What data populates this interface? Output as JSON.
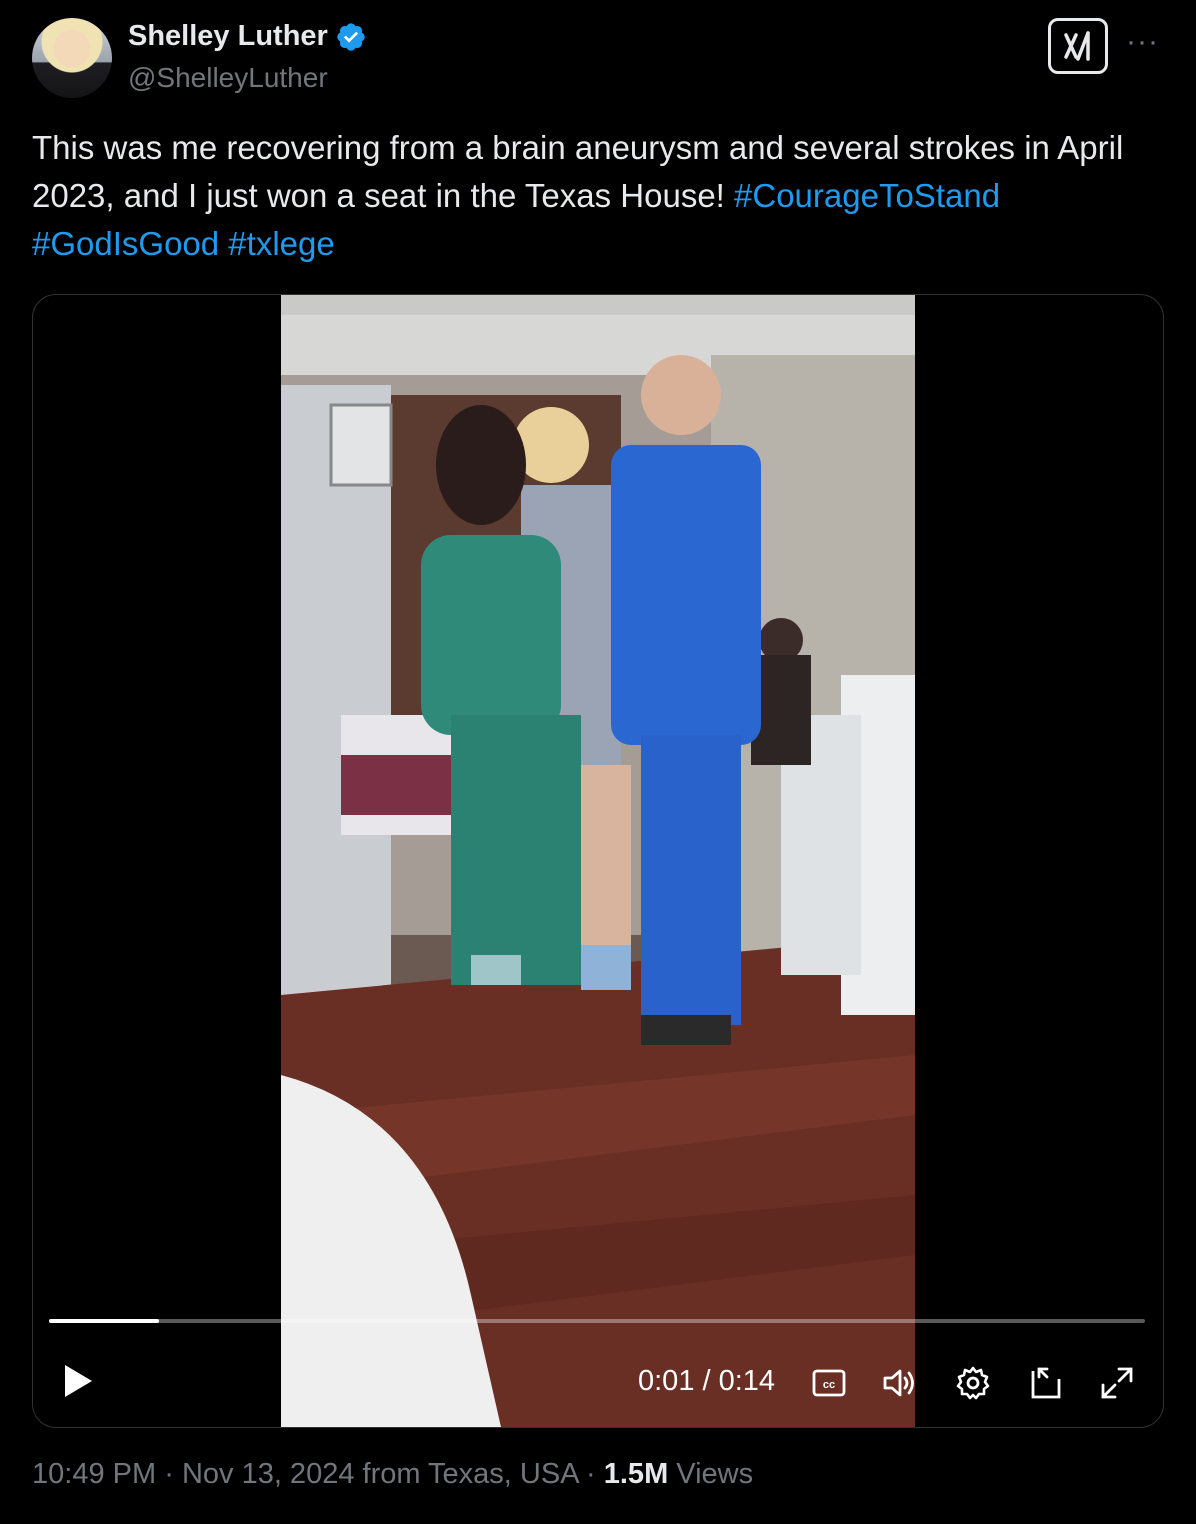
{
  "author": {
    "name": "Shelley Luther",
    "handle": "@ShelleyLuther",
    "verified": true,
    "verified_color": "#1d9bf0"
  },
  "header_actions": {
    "grok_icon": "grok-icon",
    "more_label": "···"
  },
  "tweet": {
    "text": "This was me recovering from a brain aneurysm and several strokes in April 2023, and I just won a seat in the Texas House! ",
    "hashtags": [
      "#CourageToStand",
      "#GodIsGood",
      "#txlege"
    ],
    "hashtag_color": "#1d9bf0"
  },
  "video": {
    "current_time": "0:01",
    "duration": "0:14",
    "time_display": "0:01 / 0:14",
    "progress_fraction": 0.1,
    "icons": [
      "play-icon",
      "captions-icon",
      "volume-icon",
      "settings-icon",
      "picture-in-picture-icon",
      "fullscreen-icon"
    ]
  },
  "meta": {
    "time": "10:49 PM",
    "date": "Nov 13, 2024",
    "location": "from Texas, USA",
    "views_count": "1.5M",
    "views_label": "Views",
    "separator": "·"
  }
}
